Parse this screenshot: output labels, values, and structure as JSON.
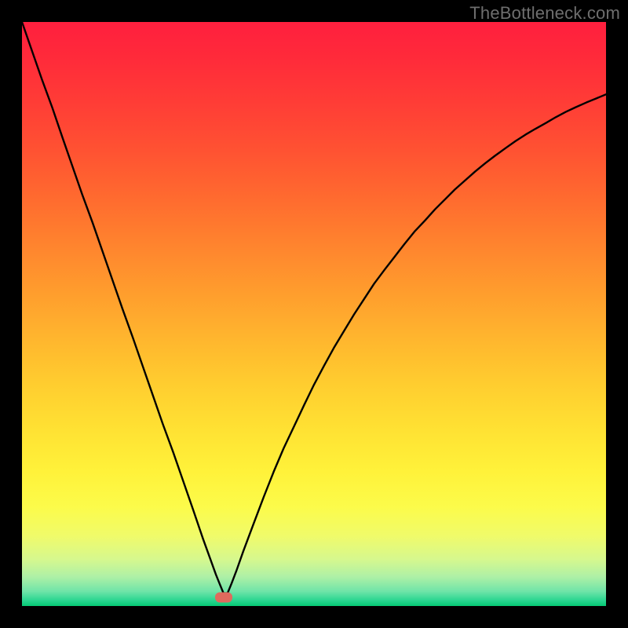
{
  "watermark": "TheBottleneck.com",
  "marker": {
    "x_frac": 0.346,
    "y_frac": 0.985
  },
  "chart_data": {
    "type": "line",
    "title": "",
    "xlabel": "",
    "ylabel": "",
    "xlim": [
      0,
      1
    ],
    "ylim": [
      0,
      1
    ],
    "x": [
      0.0,
      0.017,
      0.034,
      0.052,
      0.069,
      0.086,
      0.103,
      0.121,
      0.138,
      0.155,
      0.172,
      0.19,
      0.207,
      0.224,
      0.241,
      0.259,
      0.276,
      0.293,
      0.31,
      0.323,
      0.332,
      0.338,
      0.345,
      0.352,
      0.359,
      0.367,
      0.379,
      0.397,
      0.414,
      0.431,
      0.448,
      0.466,
      0.483,
      0.5,
      0.517,
      0.534,
      0.552,
      0.569,
      0.586,
      0.603,
      0.621,
      0.638,
      0.655,
      0.672,
      0.69,
      0.707,
      0.724,
      0.741,
      0.759,
      0.776,
      0.793,
      0.81,
      0.828,
      0.845,
      0.862,
      0.879,
      0.897,
      0.914,
      0.931,
      0.948,
      0.966,
      0.983,
      1.0
    ],
    "values": [
      1.0,
      0.951,
      0.902,
      0.853,
      0.803,
      0.754,
      0.705,
      0.656,
      0.607,
      0.558,
      0.509,
      0.459,
      0.41,
      0.361,
      0.312,
      0.263,
      0.214,
      0.165,
      0.115,
      0.079,
      0.054,
      0.039,
      0.022,
      0.022,
      0.039,
      0.06,
      0.094,
      0.142,
      0.187,
      0.23,
      0.27,
      0.308,
      0.344,
      0.379,
      0.411,
      0.442,
      0.472,
      0.5,
      0.526,
      0.552,
      0.576,
      0.598,
      0.62,
      0.641,
      0.66,
      0.679,
      0.696,
      0.713,
      0.729,
      0.744,
      0.758,
      0.771,
      0.784,
      0.796,
      0.807,
      0.817,
      0.827,
      0.837,
      0.846,
      0.854,
      0.862,
      0.869,
      0.876
    ],
    "gradient_stops": [
      {
        "offset": 0.0,
        "color": "#ff1f3e"
      },
      {
        "offset": 0.06,
        "color": "#ff2a3a"
      },
      {
        "offset": 0.14,
        "color": "#ff3d36"
      },
      {
        "offset": 0.22,
        "color": "#ff5232"
      },
      {
        "offset": 0.3,
        "color": "#ff6a2f"
      },
      {
        "offset": 0.38,
        "color": "#ff832e"
      },
      {
        "offset": 0.46,
        "color": "#ff9c2d"
      },
      {
        "offset": 0.54,
        "color": "#ffb52e"
      },
      {
        "offset": 0.62,
        "color": "#ffcd2f"
      },
      {
        "offset": 0.7,
        "color": "#ffe233"
      },
      {
        "offset": 0.77,
        "color": "#fff23a"
      },
      {
        "offset": 0.83,
        "color": "#fcfb4a"
      },
      {
        "offset": 0.88,
        "color": "#f0fb6a"
      },
      {
        "offset": 0.92,
        "color": "#d6f88e"
      },
      {
        "offset": 0.95,
        "color": "#aef0a6"
      },
      {
        "offset": 0.975,
        "color": "#6fe4a8"
      },
      {
        "offset": 0.99,
        "color": "#2cd691"
      },
      {
        "offset": 1.0,
        "color": "#05c974"
      }
    ]
  }
}
